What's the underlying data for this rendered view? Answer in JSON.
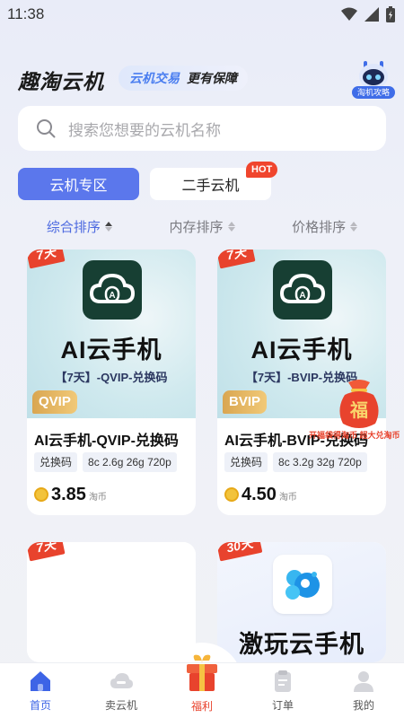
{
  "status_bar": {
    "time": "11:38",
    "icons": [
      "wifi-icon",
      "signal-icon",
      "battery-icon"
    ]
  },
  "header": {
    "brand": "趣淘云机",
    "slogan_blue": "云机交易",
    "slogan_dark": "更有保障",
    "guide_label": "淘机攻略"
  },
  "search": {
    "placeholder": "搜索您想要的云机名称"
  },
  "tabs": [
    {
      "label": "云机专区",
      "active": true
    },
    {
      "label": "二手云机",
      "badge": "HOT",
      "active": false
    }
  ],
  "sort": [
    {
      "label": "综合排序",
      "active": true
    },
    {
      "label": "内存排序",
      "active": false
    },
    {
      "label": "价格排序",
      "active": false
    }
  ],
  "products": [
    {
      "days": "7天",
      "image_title": "AI云手机",
      "image_subtitle": "【7天】-QVIP-兑换码",
      "vip": "QVIP",
      "name": "AI云手机-QVIP-兑换码",
      "tag": "兑换码",
      "spec": "8c 2.6g 26g 720p",
      "price": "3.85",
      "unit": "淘币"
    },
    {
      "days": "7天",
      "image_title": "AI云手机",
      "image_subtitle": "【7天】-BVIP-兑换码",
      "vip": "BVIP",
      "name": "AI云手机-BVIP-兑换码",
      "tag": "兑换码",
      "spec": "8c 3.2g 32g 720p",
      "price": "4.50",
      "unit": "淘币"
    },
    {
      "days": "7天"
    },
    {
      "days": "30天",
      "image_title": "激玩云手机"
    }
  ],
  "floating_promo": {
    "char": "福",
    "text": "开福袋得淘币 超大兑淘币"
  },
  "tabbar": [
    {
      "label": "首页",
      "active": true
    },
    {
      "label": "卖云机"
    },
    {
      "label": "福利"
    },
    {
      "label": "订单"
    },
    {
      "label": "我的"
    }
  ],
  "colors": {
    "accent": "#5b77ec",
    "hot": "#f0452d",
    "tag_red": "#e8432d",
    "vip_gold": "#d9a651"
  }
}
